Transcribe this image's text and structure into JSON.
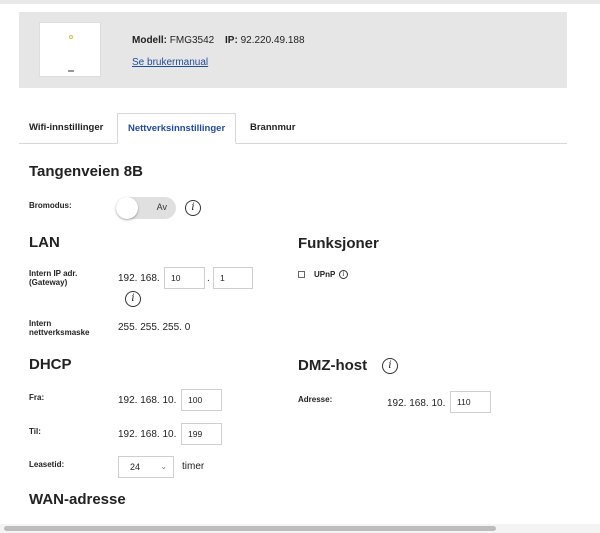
{
  "router": {
    "model_label": "Modell:",
    "model_value": "FMG3542",
    "ip_label": "IP:",
    "ip_value": "92.220.49.188",
    "manual_link": "Se brukermanual"
  },
  "tabs": [
    {
      "label": "Wifi-innstillinger",
      "active": false
    },
    {
      "label": "Nettverksinnstillinger",
      "active": true
    },
    {
      "label": "Brannmur",
      "active": false
    }
  ],
  "location": {
    "title": "Tangenveien 8B"
  },
  "bridge": {
    "label": "Bromodus:",
    "toggle_text": "Av"
  },
  "lan": {
    "title": "LAN",
    "ip_label_line1": "Intern IP adr.",
    "ip_label_line2": "(Gateway)",
    "ip_prefix": "192. 168.",
    "ip_octet3": "10",
    "ip_dot": ".",
    "ip_octet4": "1",
    "mask_label_line1": "Intern",
    "mask_label_line2": "nettverksmaske",
    "mask_value": "255. 255. 255. 0"
  },
  "functions": {
    "title": "Funksjoner",
    "upnp_label": "UPnP"
  },
  "dhcp": {
    "title": "DHCP",
    "from_label": "Fra:",
    "from_prefix": "192. 168. 10.",
    "from_value": "100",
    "to_label": "Til:",
    "to_prefix": "192. 168. 10.",
    "to_value": "199",
    "lease_label": "Leasetid:",
    "lease_value": "24",
    "lease_unit": "timer"
  },
  "dmz": {
    "title": "DMZ-host",
    "address_label": "Adresse:",
    "address_prefix": "192. 168. 10.",
    "address_value": "110"
  },
  "wan": {
    "title": "WAN-adresse"
  },
  "icons": {
    "info": "i",
    "chevron": "⌄"
  }
}
